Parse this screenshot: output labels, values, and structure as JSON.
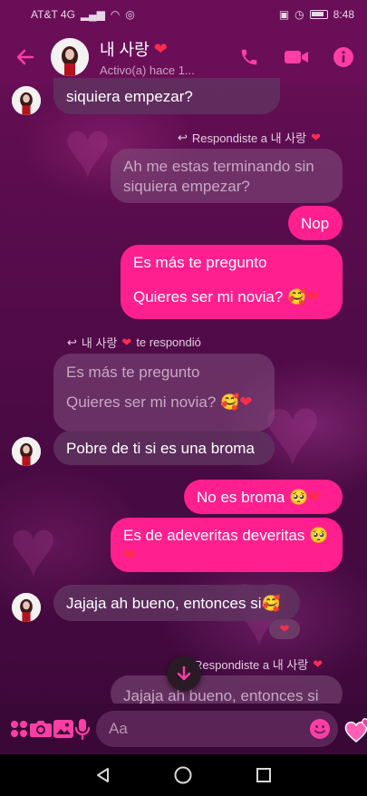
{
  "statusbar": {
    "carrier": "AT&T 4G",
    "time": "8:48"
  },
  "header": {
    "name": "내 사랑",
    "status": "Activo(a) hace 1..."
  },
  "messages": {
    "m1": "siquiera empezar?",
    "reply1": "Respondiste a 내 사랑",
    "quote1": "Ah me estas terminando sin siquiera empezar?",
    "m2": "Nop",
    "m3a": "Es más te pregunto",
    "m3b": "Quieres ser mi novia? 🥰",
    "reply2": "내 사랑",
    "reply2_suffix": "te respondió",
    "quote2a": "Es más te pregunto",
    "quote2b": "Quieres ser mi novia? 🥰",
    "m4": "Pobre de ti si es una broma",
    "m5": "No es broma 🥺",
    "m6": "Es de adeveritas deveritas 🥺",
    "m7": "Jajaja ah bueno, entonces si🥰",
    "reply3": "Respondiste a 내 사랑",
    "quote3": "Jajaja ah bueno, entonces si"
  },
  "composer": {
    "placeholder": "Aa"
  },
  "icons": {
    "back": "arrow-left-icon",
    "call": "phone-icon",
    "video": "video-camera-icon",
    "info": "info-icon",
    "apps": "four-dots-icon",
    "camera": "camera-icon",
    "gallery": "image-icon",
    "mic": "microphone-icon",
    "emoji": "smiley-icon",
    "like": "hearts-icon",
    "scroll": "arrow-down-icon"
  },
  "colors": {
    "accent": "#ff1f8e",
    "header": "#6a0e58",
    "heart": "#ff2d4d"
  }
}
